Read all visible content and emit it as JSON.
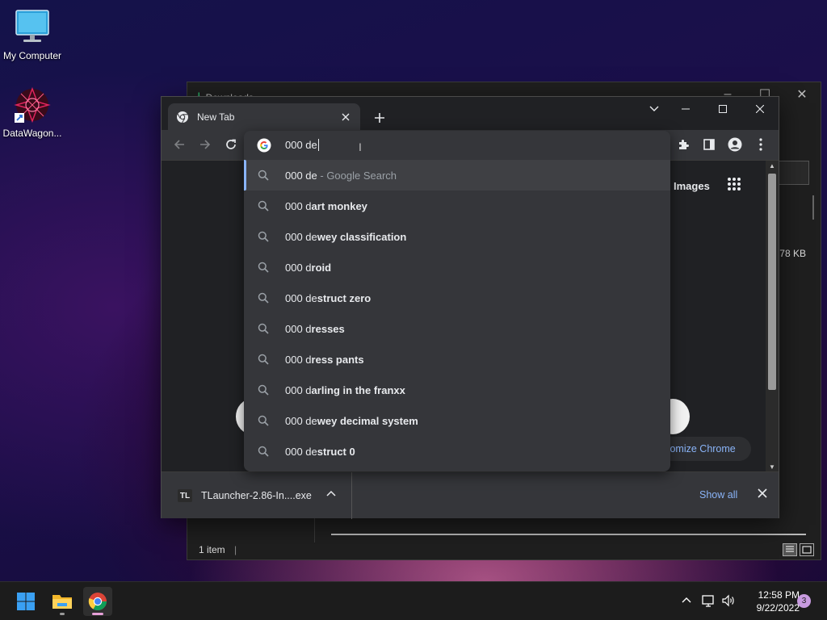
{
  "desktop": {
    "icons": [
      {
        "label": "My Computer"
      },
      {
        "label": "DataWagon..."
      }
    ]
  },
  "explorer": {
    "title": "Downloads",
    "file_size": "178 KB",
    "status": "1 item"
  },
  "chrome": {
    "tab": {
      "title": "New Tab"
    },
    "omnibox": {
      "typed_text": "000 de",
      "suggestions": [
        {
          "typed": "000 de",
          "rest": "",
          "suffix": " - Google Search"
        },
        {
          "typed": "000 d",
          "rest": "art monkey",
          "suffix": ""
        },
        {
          "typed": "000 de",
          "rest": "wey classification",
          "suffix": ""
        },
        {
          "typed": "000 d",
          "rest": "roid",
          "suffix": ""
        },
        {
          "typed": "000 de",
          "rest": "struct zero",
          "suffix": ""
        },
        {
          "typed": "000 d",
          "rest": "resses",
          "suffix": ""
        },
        {
          "typed": "000 d",
          "rest": "ress pants",
          "suffix": ""
        },
        {
          "typed": "000 d",
          "rest": "arling in the franxx",
          "suffix": ""
        },
        {
          "typed": "000 de",
          "rest": "wey decimal system",
          "suffix": ""
        },
        {
          "typed": "000 de",
          "rest": "struct 0",
          "suffix": ""
        }
      ]
    },
    "ntp": {
      "images_label": "Images",
      "customize_label": "tomize Chrome"
    },
    "download": {
      "icon_text": "TL",
      "file_name": "TLauncher-2.86-In....exe",
      "show_all": "Show all"
    }
  },
  "taskbar": {
    "time": "12:58 PM",
    "date": "9/22/2022",
    "notification_count": "3"
  },
  "colors": {
    "accent": "#8ab4f8",
    "omnibox_bg": "#35363a",
    "window_bg": "#202124"
  }
}
